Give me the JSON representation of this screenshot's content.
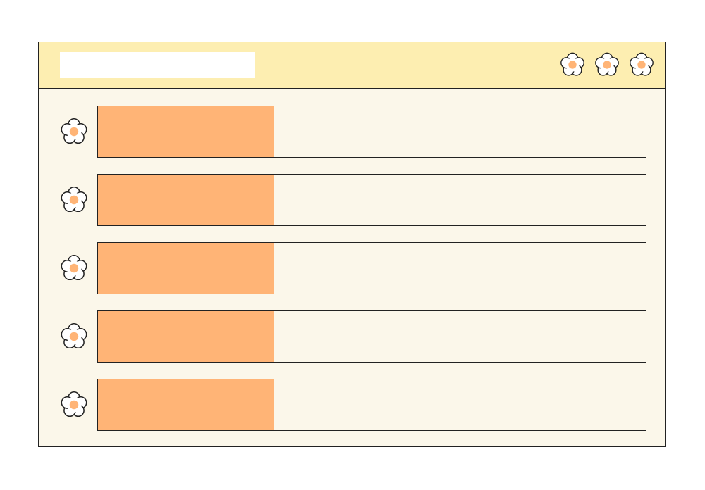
{
  "window": {
    "address_bar": {
      "value": "",
      "placeholder": ""
    },
    "controls": [
      {
        "icon": "flower-icon"
      },
      {
        "icon": "flower-icon"
      },
      {
        "icon": "flower-icon"
      }
    ]
  },
  "rows": [
    {
      "icon": "flower-icon",
      "progress": 0.32
    },
    {
      "icon": "flower-icon",
      "progress": 0.32
    },
    {
      "icon": "flower-icon",
      "progress": 0.32
    },
    {
      "icon": "flower-icon",
      "progress": 0.32
    },
    {
      "icon": "flower-icon",
      "progress": 0.32
    }
  ],
  "colors": {
    "titlebar": "#fdeeb1",
    "window_body": "#fbf7ea",
    "progress_fill": "#ffb476",
    "flower_petals": "#ffffff",
    "flower_center": "#ffb476",
    "outline": "#222222"
  }
}
